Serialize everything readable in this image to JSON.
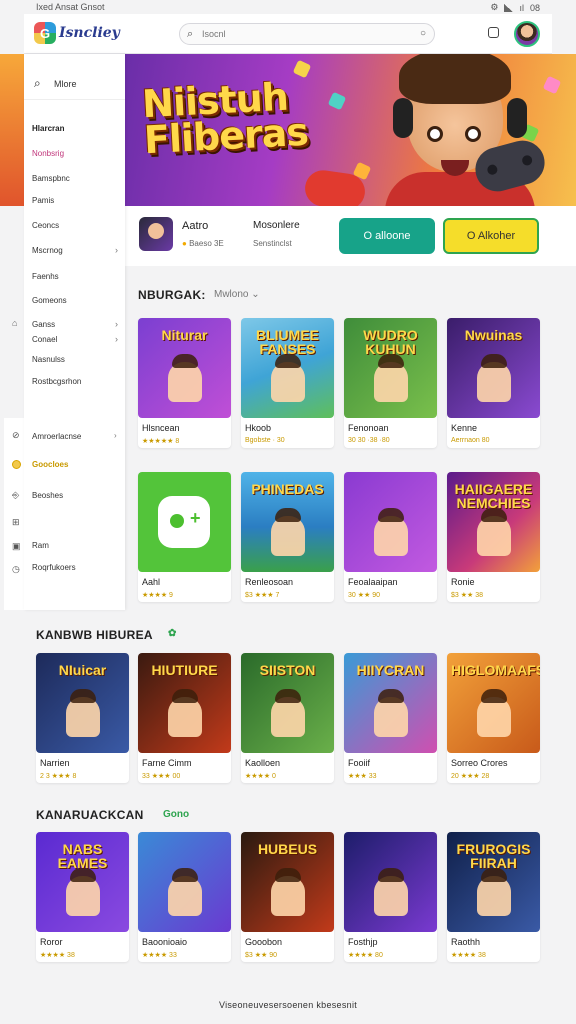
{
  "status_bar": {
    "left": "Ixed Ansat Gnsot",
    "right": "08"
  },
  "header": {
    "logo_letter": "G",
    "logo_text": "Isncliey",
    "search_placeholder": "Isocnl",
    "avatar_icon": "user-avatar"
  },
  "sidebar": {
    "search_label": "Mlore",
    "items": [
      {
        "label": "Hlarcran",
        "style": "head"
      },
      {
        "label": "Nonbsrig",
        "style": "active"
      },
      {
        "label": "Bamspbnc",
        "style": ""
      },
      {
        "label": "Pamis",
        "style": ""
      },
      {
        "label": "Ceoncs",
        "style": ""
      },
      {
        "label": "Mscrnog",
        "style": "",
        "chevron": true
      },
      {
        "label": "Faenhs",
        "style": ""
      },
      {
        "label": "Gomeons",
        "style": ""
      },
      {
        "label": "Ganss",
        "style": "",
        "chevron": true
      },
      {
        "label": "Conael",
        "style": "",
        "chevron": true
      },
      {
        "label": "Nasnulss",
        "style": ""
      },
      {
        "label": "Rostbcgsrhon",
        "style": ""
      }
    ],
    "bottom_items": [
      {
        "label": "Amroerlacnse",
        "chevron": true,
        "style": ""
      },
      {
        "label": "Goocloes",
        "style": "gold"
      },
      {
        "label": "Beoshes",
        "style": ""
      },
      {
        "label": "Ram",
        "style": ""
      },
      {
        "label": "Roqrfukoers",
        "style": ""
      }
    ]
  },
  "banner": {
    "title_line1": "Niistuh",
    "title_line2": "Fliberas"
  },
  "featured": {
    "name": "Aatro",
    "meta": "Baeso 3E",
    "col2_title": "Mosonlere",
    "col2_meta": "Senstinclst",
    "btn_primary": "O alloone",
    "btn_secondary": "O Alkoher"
  },
  "sections": [
    {
      "title": "NBURGAK:",
      "subtitle": "Mwlono",
      "games": [
        {
          "title": "Hlsncean",
          "rating": "★★★★★ 8",
          "art_label": "Niturar",
          "bg": "linear-gradient(135deg,#7b3fd1,#c04fd6)"
        },
        {
          "title": "Hkoob",
          "rating": "Bgobste · 30",
          "art_label": "BLIUMEE FANSES",
          "bg": "linear-gradient(160deg,#7ec8e8,#3fa4d6 50%,#5fbf5a)"
        },
        {
          "title": "Fenonoan",
          "rating": "30 30 ·38 ·80",
          "art_label": "WUDRO KUHUN",
          "bg": "linear-gradient(135deg,#3f8d3a,#7ac04c)"
        },
        {
          "title": "Kenne",
          "rating": "Aerrnaon 80",
          "art_label": "Nwuinas",
          "bg": "linear-gradient(135deg,#3a1d6a,#8a4ad1)"
        }
      ]
    },
    {
      "title": "",
      "subtitle": "",
      "games": [
        {
          "title": "Aahl",
          "rating": "★★★★ 9",
          "art_label": "",
          "bg": "#53c43a",
          "pad": true
        },
        {
          "title": "Renleosoan",
          "rating": "$3 ★★★ 7",
          "art_label": "PHINEDAS",
          "bg": "linear-gradient(180deg,#4fb3e8,#2b7ec2 55%,#3aa04a)"
        },
        {
          "title": "Feoalaaipan",
          "rating": "30 ★★ 90",
          "art_label": "",
          "bg": "linear-gradient(135deg,#8a3ad1,#c25ae0)"
        },
        {
          "title": "Ronie",
          "rating": "$3 ★★ 38",
          "art_label": "HAIIGAERE NEMCHIES",
          "bg": "linear-gradient(135deg,#5a1a8a,#c83a7a 60%,#f2a13a)"
        }
      ]
    },
    {
      "title": "KANBWB HIBUREA",
      "tag": "✿",
      "games": [
        {
          "title": "Narrien",
          "rating": "2 3 ★★★ 8",
          "art_label": "NIuicar",
          "bg": "linear-gradient(135deg,#1d2a5a,#3a5aa6)"
        },
        {
          "title": "Farne Cimm",
          "rating": "33 ★★★ 00",
          "art_label": "HIUTIURE",
          "bg": "linear-gradient(135deg,#3a1a10,#c23a1a)"
        },
        {
          "title": "Kaolloen",
          "rating": "★★★★ 0",
          "art_label": "SIISTON",
          "bg": "linear-gradient(135deg,#2a6a2a,#6ab04a)"
        },
        {
          "title": "Fooiif",
          "rating": "★★★ 33",
          "art_label": "HIIYCRAN",
          "bg": "linear-gradient(135deg,#3a9ad6,#d04fb0)"
        },
        {
          "title": "Sorreo Crores",
          "rating": "20 ★★★ 28",
          "art_label": "HIGLOMAAFS",
          "bg": "linear-gradient(135deg,#f2a13a,#c85a1a)"
        }
      ]
    },
    {
      "title": "KANARUACKCAN",
      "tag": "Gono",
      "games": [
        {
          "title": "Roror",
          "rating": "★★★★ 38",
          "art_label": "NABS EAMES",
          "bg": "linear-gradient(135deg,#5a2ad1,#8a4ae0)"
        },
        {
          "title": "Baoonioaio",
          "rating": "★★★★ 33",
          "art_label": "",
          "bg": "linear-gradient(135deg,#3a8ad6,#6a3ad1)"
        },
        {
          "title": "Gooobon",
          "rating": "$3 ★★ 90",
          "art_label": "HUBEUS",
          "bg": "linear-gradient(135deg,#2a1a10,#c23a1a)"
        },
        {
          "title": "Fosthjp",
          "rating": "★★★★ 80",
          "art_label": "",
          "bg": "linear-gradient(135deg,#1d1d6a,#7a3ad1)"
        },
        {
          "title": "Raothh",
          "rating": "★★★★ 38",
          "art_label": "FRUROGIS FIIRAH",
          "bg": "linear-gradient(135deg,#10204a,#3a5aa6)"
        }
      ]
    }
  ],
  "footer": {
    "text": "Viseoneuvesersoenen kbesesnit"
  },
  "colors": {
    "accent_green": "#17a389",
    "accent_yellow": "#f5dd2a",
    "star": "#f2a900"
  }
}
